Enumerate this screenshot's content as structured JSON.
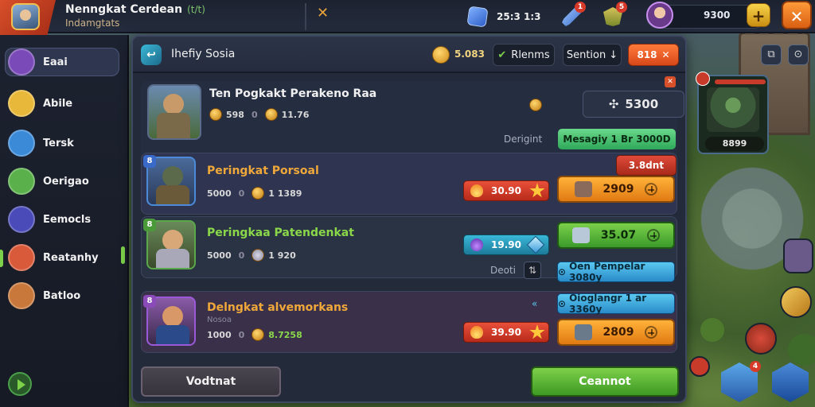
{
  "topbar": {
    "player_name": "Nenngkat Cerdean",
    "player_level": "(t/t)",
    "player_subtitle": "Indamgtats",
    "close_x": "✕",
    "gems": "25:3 1:3",
    "sword_badge": "1",
    "shield_badge": "5",
    "profile_value": "9300",
    "plus_label": "+",
    "close_label": "✕"
  },
  "sidebar": {
    "items": [
      {
        "label": "Eaai",
        "color": "#7a4ab8"
      },
      {
        "label": "Abile",
        "color": "#e8b83a"
      },
      {
        "label": "Tersk",
        "color": "#3a8ad8"
      },
      {
        "label": "Oerigao",
        "color": "#5ab04a"
      },
      {
        "label": "Eemocls",
        "color": "#4a4ab8"
      },
      {
        "label": "Reatanhy",
        "color": "#d85a3a"
      },
      {
        "label": "Batloo",
        "color": "#c8783a"
      }
    ]
  },
  "panel": {
    "title": "Ihefiy Sosia",
    "title_icon": "↩",
    "gold_value": "5.083",
    "filter_label": "Rlenms",
    "filter_icon": "✔",
    "section_label": "Sention",
    "section_arrow": "↓",
    "red_btn_label": "818",
    "red_btn_icon": "✕"
  },
  "featured": {
    "title": "Ten Pogkakt Perakeno Raa",
    "stat1": "598",
    "stat1_sep": "0",
    "stat2": "11.76",
    "price": "5300",
    "price_icon": "✣",
    "label": "Derigint",
    "action": "Mesagiy 1 Br 3000D",
    "close": "✕"
  },
  "offers": [
    {
      "tier": "8",
      "title": "Peringkat Porsoal",
      "title_color": "#f0a83a",
      "stat1": "5000",
      "stat1_sep": "0",
      "stat2": "1 1389",
      "cost": "30.90",
      "buy": "2909",
      "top_label": "3.8dnt",
      "extra_label": ""
    },
    {
      "tier": "8",
      "title": "Peringkaa Patendenkat",
      "title_color": "#8ad84a",
      "stat1": "5000",
      "stat1_sep": "0",
      "stat2": "1 920",
      "cost": "19.90",
      "buy": "35.07",
      "bottom_label": "Deoti",
      "bottom_icon": "⇅",
      "action": "Oen Pempelar 3080y",
      "action_icon": "⊙"
    },
    {
      "tier": "8",
      "title": "Delngkat alvemorkans",
      "title_color": "#f0a83a",
      "stat1": "1000",
      "stat1_sep": "0",
      "stat1_sub": "Nosoa",
      "stat2": "8.7258",
      "cost": "39.90",
      "buy": "2809",
      "action": "Oioglangr 1 ar 3360y",
      "action_icon": "⊙",
      "arrow": "«"
    }
  ],
  "footer": {
    "cancel_label": "Vodtnat",
    "confirm_label": "Ceannot"
  },
  "right": {
    "char_value": "8899",
    "map_btn_1": "⧉",
    "map_btn_2": "⊙",
    "hex_badge": "4"
  }
}
